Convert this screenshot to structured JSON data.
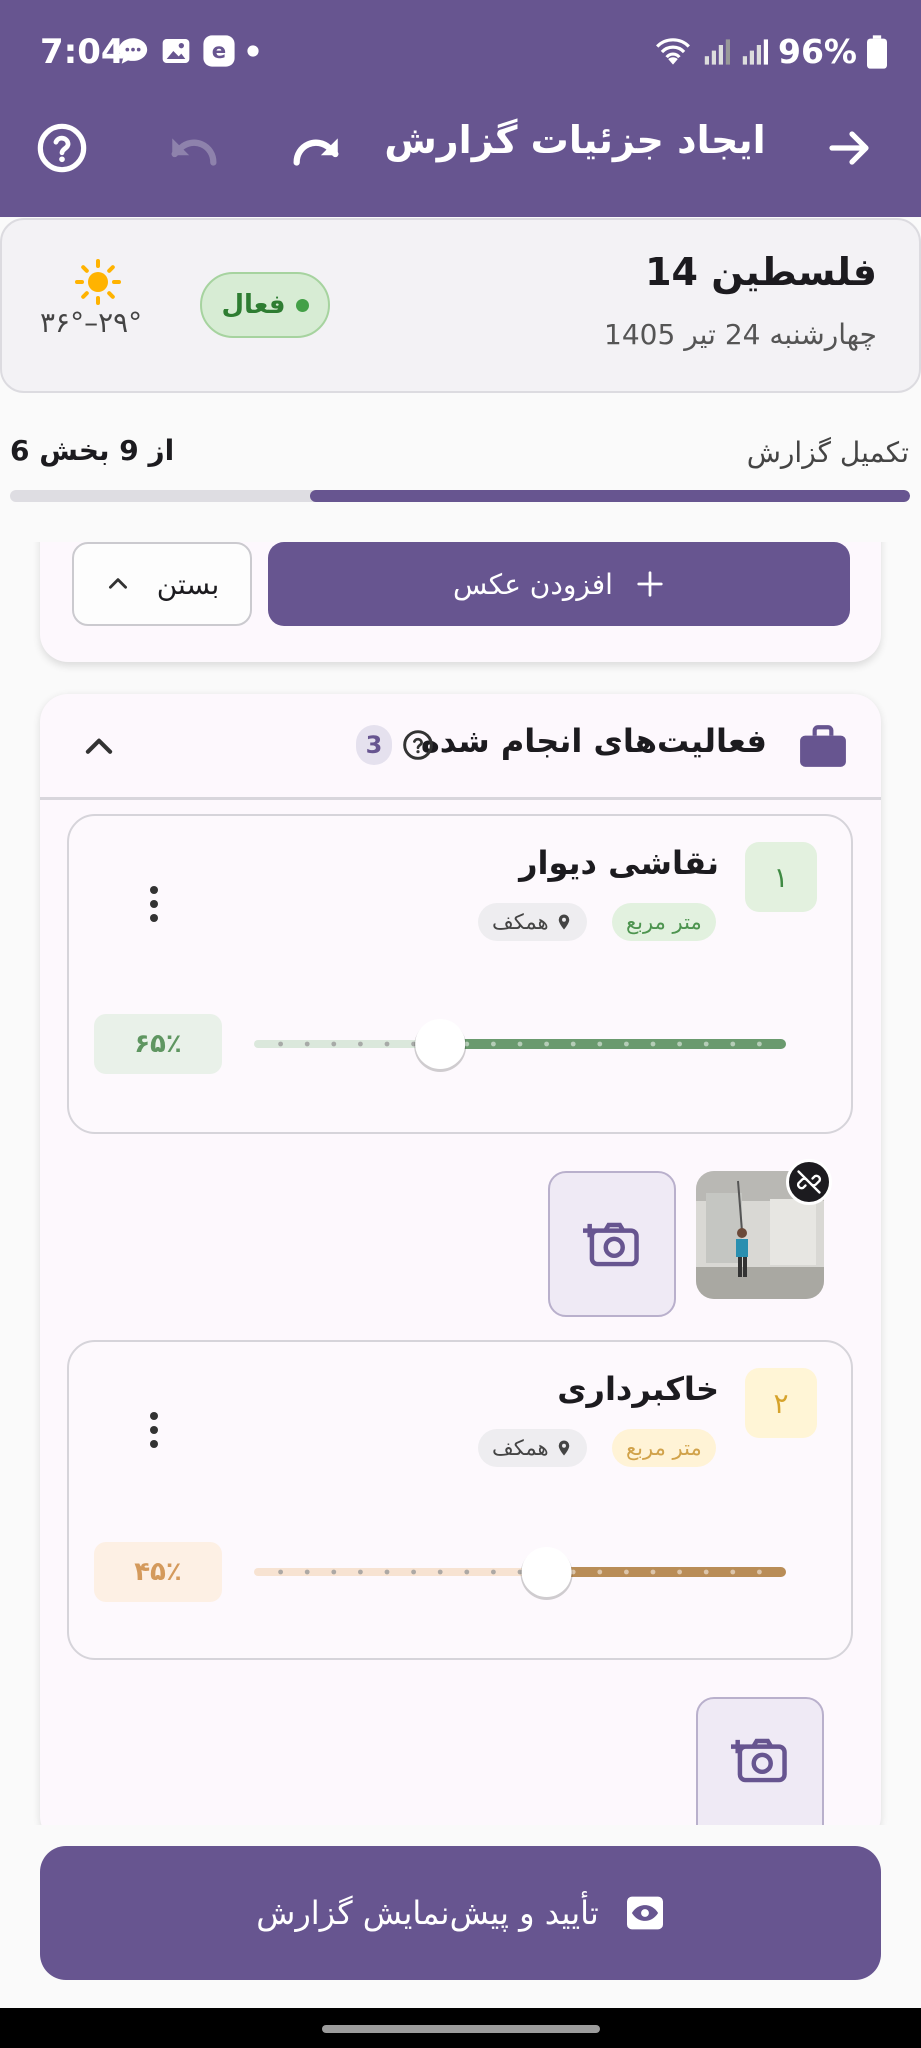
{
  "status_bar": {
    "time": "7:04",
    "battery": "96%"
  },
  "app_bar": {
    "title": "ایجاد جزئیات گزارش"
  },
  "project": {
    "name": "فلسطین 14",
    "date": "چهارشنبه 24 تیر 1405",
    "status": "فعال",
    "temperature": "۳۶°–۲۹°"
  },
  "progress": {
    "label": "تکمیل گزارش",
    "count": "6 از 9 بخش",
    "completed": 6,
    "total": 9
  },
  "photos_section": {
    "add_photo_label": "افزودن عکس",
    "close_label": "بستن"
  },
  "activities": {
    "title": "فعالیت‌های انجام شده",
    "count": "3",
    "items": [
      {
        "number": "۱",
        "title": "نقاشی دیوار",
        "unit": "متر مربع",
        "location": "همکف",
        "percent_label": "۶۵٪",
        "percent": 65
      },
      {
        "number": "۲",
        "title": "خاکبرداری",
        "unit": "متر مربع",
        "location": "همکف",
        "percent_label": "۴۵٪",
        "percent": 45
      }
    ]
  },
  "confirm_button": {
    "label": "تأیید و پیش‌نمایش گزارش"
  },
  "colors": {
    "primary": "#675590",
    "green": "#6a9a6e",
    "amber": "#b98d57"
  },
  "icons": [
    "help-icon",
    "undo-icon",
    "redo-icon",
    "forward-arrow-icon",
    "sun-icon",
    "briefcase-icon",
    "add-photo-icon",
    "unlink-icon",
    "eye-icon",
    "location-pin-icon",
    "chevron-up-icon",
    "plus-icon"
  ]
}
